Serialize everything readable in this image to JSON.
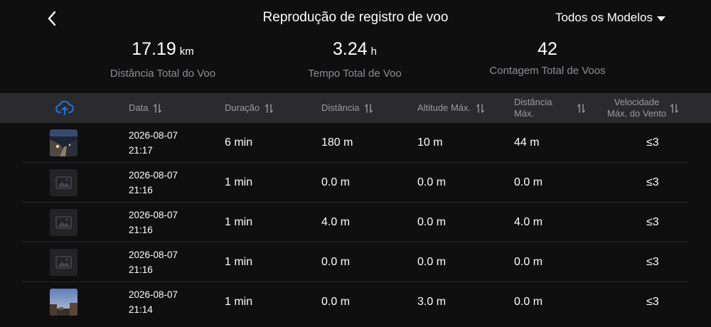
{
  "header": {
    "title": "Reprodução de registro de voo",
    "model_filter": "Todos os Modelos"
  },
  "stats": [
    {
      "value": "17.19",
      "unit": "km",
      "label": "Distância Total do Voo"
    },
    {
      "value": "3.24",
      "unit": "h",
      "label": "Tempo Total de Voo"
    },
    {
      "value": "42",
      "unit": "",
      "label": "Contagem Total de Voos"
    }
  ],
  "columns": {
    "date": "Data",
    "duration": "Duração",
    "distance": "Distância",
    "max_altitude": "Altitude Máx.",
    "max_distance_line1": "Distância",
    "max_distance_line2": "Máx.",
    "max_wind_line1": "Velocidade",
    "max_wind_line2": "Máx. do Vento"
  },
  "rows": [
    {
      "date": "2026-08-07",
      "time": "21:17",
      "duration": "6 min",
      "distance": "180 m",
      "max_altitude": "10 m",
      "max_distance": "44 m",
      "wind": "≤3",
      "thumb": "night-street-photo"
    },
    {
      "date": "2026-08-07",
      "time": "21:16",
      "duration": "1 min",
      "distance": "0.0 m",
      "max_altitude": "0.0 m",
      "max_distance": "0.0 m",
      "wind": "≤3",
      "thumb": "image-placeholder-icon"
    },
    {
      "date": "2026-08-07",
      "time": "21:16",
      "duration": "1 min",
      "distance": "4.0 m",
      "max_altitude": "0.0 m",
      "max_distance": "4.0 m",
      "wind": "≤3",
      "thumb": "image-placeholder-icon"
    },
    {
      "date": "2026-08-07",
      "time": "21:16",
      "duration": "1 min",
      "distance": "0.0 m",
      "max_altitude": "0.0 m",
      "max_distance": "0.0 m",
      "wind": "≤3",
      "thumb": "image-placeholder-icon"
    },
    {
      "date": "2026-08-07",
      "time": "21:14",
      "duration": "1 min",
      "distance": "0.0 m",
      "max_altitude": "3.0 m",
      "max_distance": "0.0 m",
      "wind": "≤3",
      "thumb": "dusk-sky-photo"
    }
  ],
  "colors": {
    "background": "#0f0f10",
    "header_bg": "#2b2b2f",
    "accent_blue": "#1e7bf0",
    "muted_text": "#8e8e93"
  },
  "icons": {
    "back": "chevron-left-icon",
    "cloud": "cloud-upload-icon",
    "sort": "sort-arrows-icon",
    "dropdown": "caret-down-icon"
  }
}
